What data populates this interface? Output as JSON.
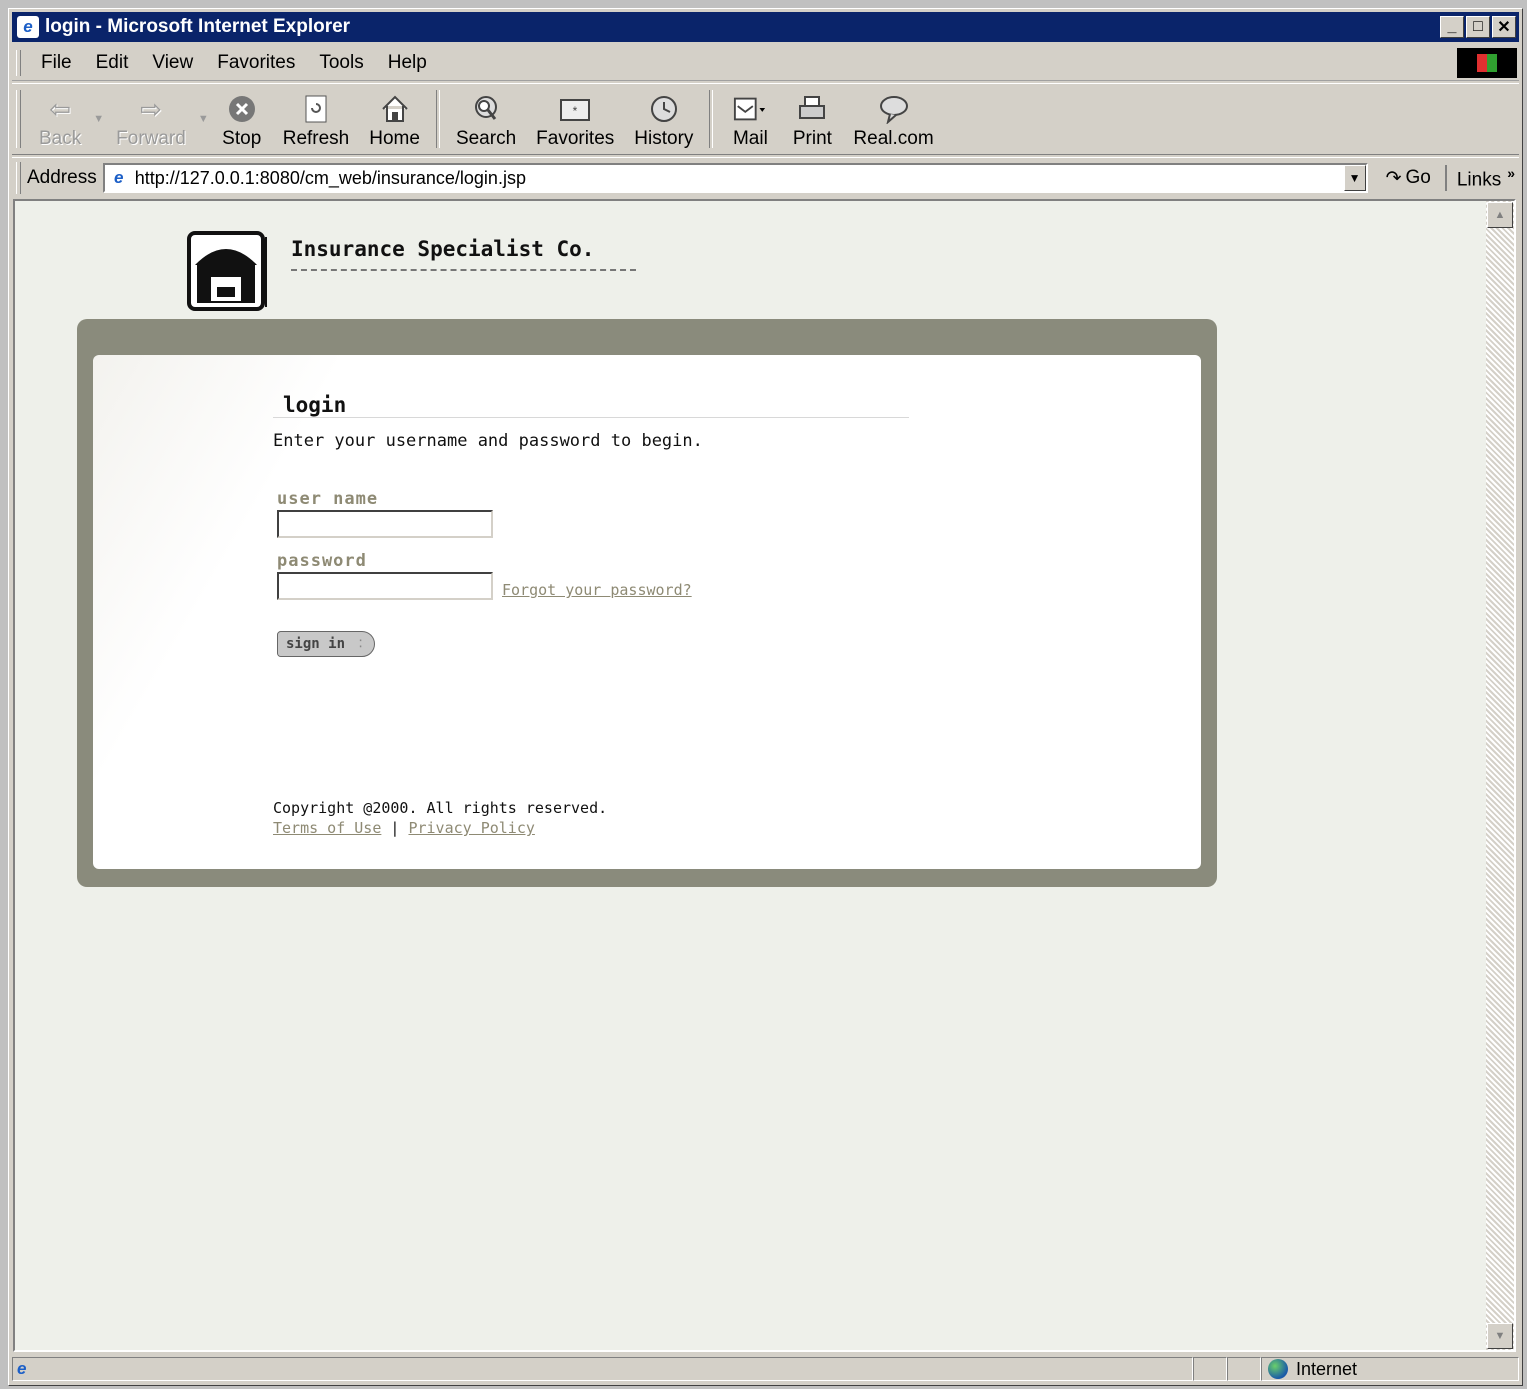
{
  "window": {
    "title": "login - Microsoft Internet Explorer",
    "min": "_",
    "max": "□",
    "close": "✕"
  },
  "menu": [
    {
      "label": "File"
    },
    {
      "label": "Edit"
    },
    {
      "label": "View"
    },
    {
      "label": "Favorites"
    },
    {
      "label": "Tools"
    },
    {
      "label": "Help"
    }
  ],
  "toolbar": {
    "back": "Back",
    "forward": "Forward",
    "stop": "Stop",
    "refresh": "Refresh",
    "home": "Home",
    "search": "Search",
    "favorites": "Favorites",
    "history": "History",
    "mail": "Mail",
    "print": "Print",
    "real": "Real.com"
  },
  "address": {
    "label": "Address",
    "url": "http://127.0.0.1:8080/cm_web/insurance/login.jsp",
    "go": "Go",
    "links": "Links"
  },
  "page": {
    "company": "Insurance Specialist Co.",
    "login_title": "login",
    "intro": "Enter your username and password to begin.",
    "username_label": "user name",
    "username_value": "",
    "password_label": "password",
    "password_value": "",
    "forgot": "Forgot your password?",
    "signin": "sign in",
    "copyright": "Copyright @2000. All rights reserved.",
    "terms": "Terms of Use",
    "separator": "|",
    "privacy": "Privacy Policy"
  },
  "status": {
    "zone": "Internet"
  },
  "colors": {
    "titlebar": "#0a246a",
    "panel": "#8a8b7c",
    "label": "#8e8a74",
    "page_bg": "#eef0ea"
  }
}
